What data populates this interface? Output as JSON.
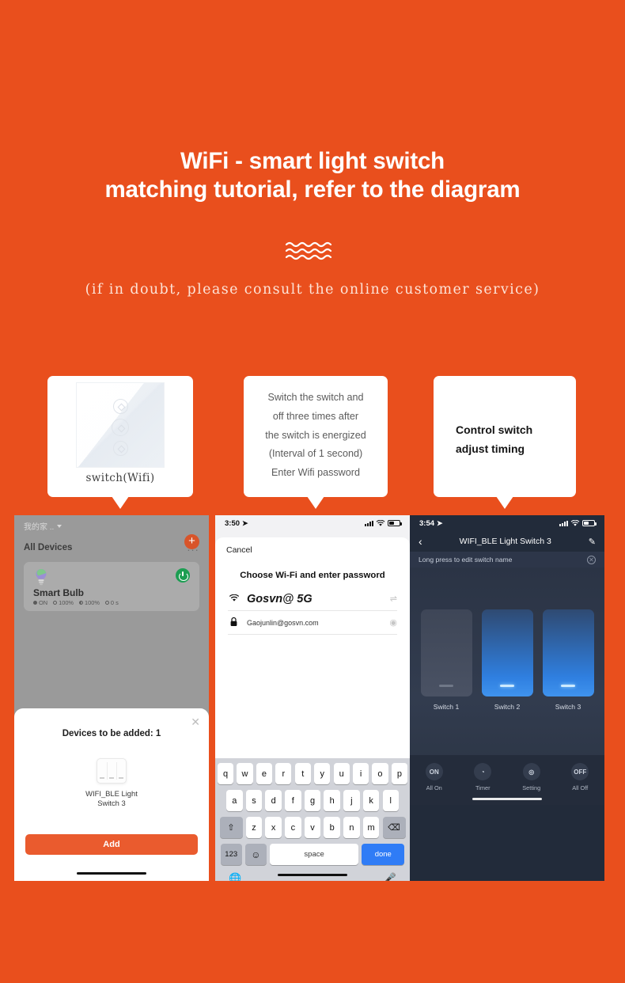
{
  "theme": {
    "background": "#e94f1d",
    "accent": "#ea5b2e",
    "white": "#ffffff"
  },
  "hero": {
    "title_line1": "WiFi - smart light switch",
    "title_line2": "matching tutorial, refer to the diagram",
    "divider_icon": "wave-lines-icon",
    "subnote": "(if in doubt, please consult the online customer service)"
  },
  "callouts": [
    {
      "id": "switch-product",
      "image_icon": "three-gang-touch-switch-image",
      "caption": "switch(Wifi)"
    },
    {
      "id": "instructions",
      "lines": [
        "Switch the switch and",
        "off three times after",
        "the switch is energized",
        "(Interval of 1 second)",
        "Enter Wifi password"
      ]
    },
    {
      "id": "control",
      "lines": [
        "Control switch",
        "adjust timing"
      ]
    }
  ],
  "phone1": {
    "statusbar": {
      "visible": false
    },
    "home_label": "我的家 ..",
    "add_button": "+",
    "section_title": "All Devices",
    "more_button": "...",
    "device_card": {
      "name": "Smart Bulb",
      "power_icon": "power-on-icon",
      "bulb_icon": "light-bulb-icon",
      "stats": [
        {
          "icon": "status-dot-icon",
          "value": "ON"
        },
        {
          "icon": "brightness-icon",
          "value": "100%"
        },
        {
          "icon": "color-temp-icon",
          "value": "100%"
        },
        {
          "icon": "timer-icon",
          "value": "0 s"
        }
      ]
    },
    "sheet": {
      "close_icon": "close-icon",
      "title": "Devices to be added: 1",
      "device_icon": "three-gang-switch-icon",
      "device_name_line1": "WIFI_BLE Light",
      "device_name_line2": "Switch 3",
      "add_label": "Add"
    }
  },
  "phone2": {
    "statusbar": {
      "time": "3:50",
      "location_icon": "location-arrow-icon",
      "signal_icon": "signal-bars-icon",
      "wifi_icon": "wifi-icon",
      "battery_icon": "battery-icon"
    },
    "cancel_label": "Cancel",
    "heading": "Choose Wi-Fi and enter password",
    "ssid": {
      "icon": "wifi-icon",
      "value": "Gosvn@ 5G",
      "action_icon": "switch-network-icon"
    },
    "password": {
      "icon": "lock-icon",
      "value": "Gaojunlin@gosvn.com",
      "action_icon": "eye-icon"
    },
    "keyboard": {
      "row1": [
        "q",
        "w",
        "e",
        "r",
        "t",
        "y",
        "u",
        "i",
        "o",
        "p"
      ],
      "row2": [
        "a",
        "s",
        "d",
        "f",
        "g",
        "h",
        "j",
        "k",
        "l"
      ],
      "row3_shift": "⇧",
      "row3": [
        "z",
        "x",
        "c",
        "v",
        "b",
        "n",
        "m"
      ],
      "row3_backspace": "⌫",
      "numbers_key": "123",
      "emoji_key": "☺",
      "space_key": "space",
      "done_key": "done",
      "globe_icon": "globe-icon",
      "mic_icon": "microphone-icon"
    }
  },
  "phone3": {
    "statusbar": {
      "time": "3:54",
      "location_icon": "location-arrow-icon",
      "signal_icon": "signal-bars-icon",
      "wifi_icon": "wifi-icon",
      "battery_icon": "battery-icon"
    },
    "nav": {
      "back_icon": "chevron-left-icon",
      "title": "WIFI_BLE Light Switch 3",
      "edit_icon": "pencil-edit-icon"
    },
    "notice": {
      "text": "Long press to edit switch name",
      "close_icon": "close-circle-icon"
    },
    "switches": [
      {
        "label": "Switch 1",
        "state": "off"
      },
      {
        "label": "Switch 2",
        "state": "on"
      },
      {
        "label": "Switch 3",
        "state": "on"
      }
    ],
    "tools": [
      {
        "icon_text": "ON",
        "icon_name": "all-on-icon",
        "label": "All On"
      },
      {
        "icon_text": "◔",
        "icon_name": "timer-icon",
        "label": "Timer"
      },
      {
        "icon_text": "◎",
        "icon_name": "setting-icon",
        "label": "Setting"
      },
      {
        "icon_text": "OFF",
        "icon_name": "all-off-icon",
        "label": "All Off"
      }
    ]
  }
}
